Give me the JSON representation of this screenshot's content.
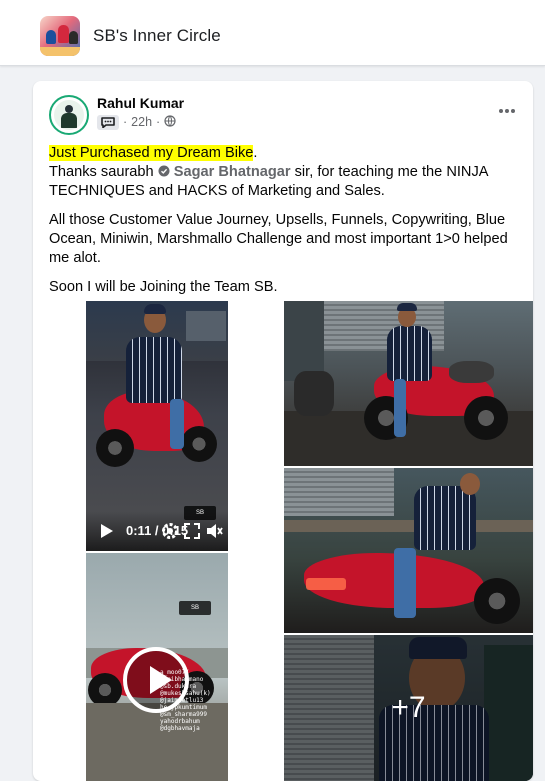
{
  "group": {
    "name": "SB's Inner Circle"
  },
  "post": {
    "author": "Rahul Kumar",
    "time": "22h",
    "separator": "·",
    "paragraphs": {
      "p1_highlight": "Just Purchased my Dream Bike",
      "p1_after": ".",
      "p1_line2_a": "Thanks saurabh ",
      "p1_mention": "Sagar Bhatnagar",
      "p1_line2_b": "  sir, for teaching me the NINJA TECHNIQUES and HACKS of Marketing and Sales.",
      "p2": "All those Customer Value Journey, Upsells, Funnels, Copywriting, Blue Ocean, Miniwin, Marshmallo Challenge and most important 1>0 helped me alot.",
      "p3": "Soon I will be Joining the Team SB."
    },
    "video": {
      "time": "0:11 / 0:15"
    },
    "watermark": "SB\nInner",
    "more_photos": "+7",
    "overlay_caption": "a_moo07/\n@vaibhavmano\n@sb.dukhra\n@mukeshsahu(k)\n@jaimeetlu13\nhe jpkumtimum\n@sm_sharma999\nyahodrbahum\n@dgbhavmaja"
  },
  "icons": {
    "more": "more-horizontal-icon",
    "group_badge": "group-chat-icon",
    "audience": "globe-icon",
    "verified": "verified-badge-icon",
    "play": "play-icon",
    "settings": "settings-gear-icon",
    "fullscreen": "fullscreen-icon",
    "mute": "volume-mute-icon"
  },
  "colors": {
    "highlight": "#ffff00",
    "avatar_ring": "#19a974",
    "text": "#050505",
    "secondary": "#65676b"
  }
}
